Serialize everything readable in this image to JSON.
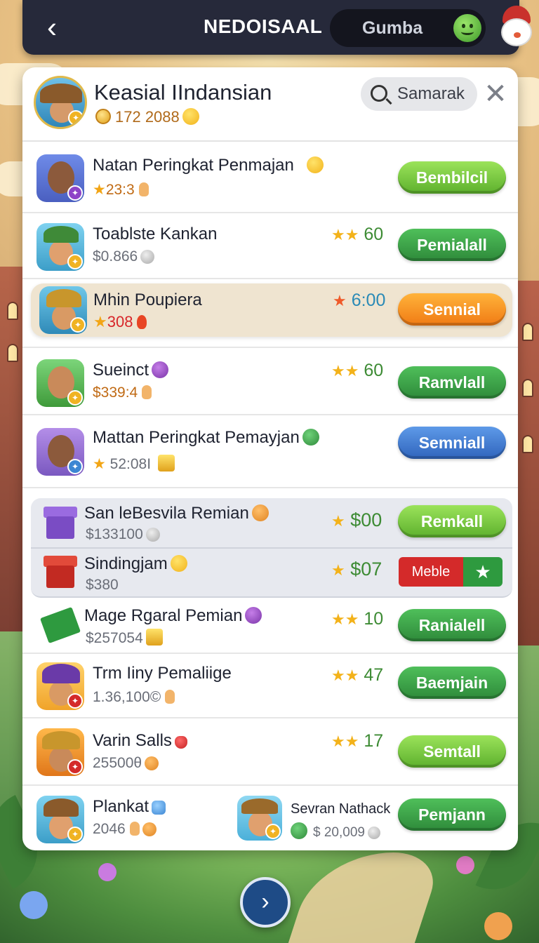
{
  "topbar": {
    "title": "NEDOISAAL",
    "user_name": "Gumba"
  },
  "header": {
    "player_name": "Keasial IIndansian",
    "coins": "172 2088",
    "search_placeholder": "Samarak"
  },
  "rows": [
    {
      "name": "Natan Peringkat Penmajan",
      "sub": "23:3",
      "score": "",
      "button": "Bembilcil"
    },
    {
      "name": "Toablste Kankan",
      "sub": "$0.866",
      "score": "60",
      "button": "Pemialall"
    },
    {
      "name": "Mhin Poupiera",
      "sub": "308",
      "score": "6:00",
      "button": "Sennial"
    },
    {
      "name": "Sueinct",
      "sub": "$339:4",
      "score": "60",
      "button": "Ramvlall"
    },
    {
      "name": "Mattan Peringkat Pemayjan",
      "sub": "52:08I",
      "score": "",
      "button": "Semniall"
    },
    {
      "name": "San leBesvila Remian",
      "sub": "$133100",
      "score": "$00",
      "button": "Remkall"
    },
    {
      "name": "Sindingjam",
      "sub": "$380",
      "score": "$07",
      "button_a": "Meble",
      "button_b": "★"
    },
    {
      "name": "Mage Rgaral Pemian",
      "sub": "$257054",
      "score": "10",
      "button": "Ranialell"
    },
    {
      "name": "Trm Iiny Pemaliige",
      "sub": "1.36,100©",
      "score": "47",
      "button": "Baemjain"
    },
    {
      "name": "Varin Salls",
      "sub": "25500θ",
      "score": "17",
      "button": "Semtall"
    },
    {
      "name": "Plankat",
      "sub": "2046",
      "button": "Pemjann"
    }
  ],
  "friend": {
    "name": "Sevran Nathack",
    "coins": "$ 20,009"
  },
  "colors": {
    "topbar": "#26293a",
    "button_green_light": "#6fc23a",
    "button_green_dark": "#2e8a3a",
    "button_orange": "#f58a1e",
    "button_blue": "#3a72c8",
    "highlight_row": "#efe4d0"
  },
  "icons": {
    "back": "chevron-left-icon",
    "next": "chevron-right-icon",
    "close": "close-icon",
    "search": "search-icon",
    "coin": "coin-icon",
    "star": "star-icon"
  }
}
